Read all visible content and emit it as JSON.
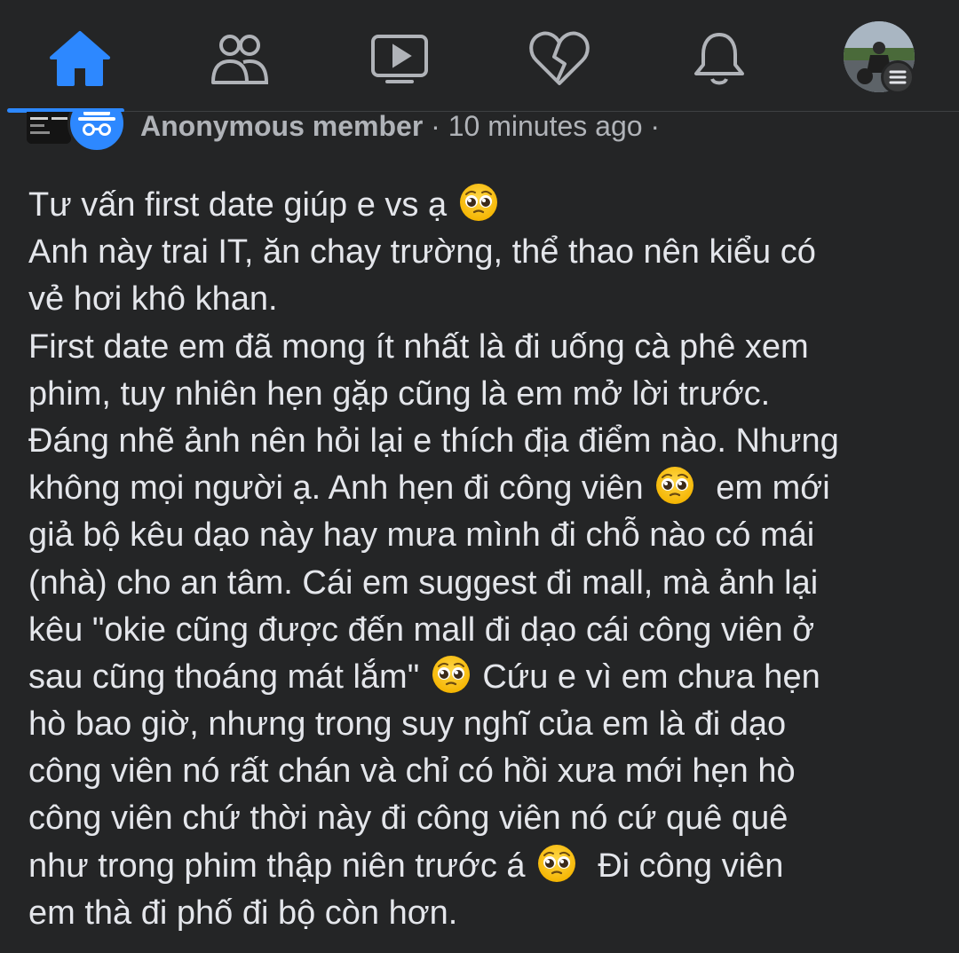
{
  "nav": {
    "items": [
      {
        "name": "home",
        "active": true
      },
      {
        "name": "friends",
        "active": false
      },
      {
        "name": "watch",
        "active": false
      },
      {
        "name": "dating",
        "active": false
      },
      {
        "name": "notifications",
        "active": false
      },
      {
        "name": "profile-menu",
        "active": false
      }
    ],
    "accent_color": "#2d88ff"
  },
  "post": {
    "author": "Anonymous member",
    "separator1": " · ",
    "time": "10 minutes ago",
    "separator2": " ·",
    "lines": [
      {
        "text": "Tư vấn first date giúp e vs ạ",
        "emoji": "pleading-face"
      },
      {
        "text": "Anh này trai IT, ăn chay trường, thể thao nên kiểu có"
      },
      {
        "text": "vẻ hơi khô khan."
      },
      {
        "text": "First date em đã mong ít nhất là đi uống cà phê xem"
      },
      {
        "text": "phim, tuy nhiên hẹn gặp cũng là em mở lời trước."
      },
      {
        "text": "Đáng nhẽ ảnh nên hỏi lại e thích địa điểm nào. Nhưng"
      },
      {
        "text": "không mọi người ạ. Anh hẹn đi công viên",
        "emoji": "pleading-face",
        "after": "  em mới"
      },
      {
        "text": "giả bộ kêu dạo này hay mưa mình đi chỗ nào có mái"
      },
      {
        "text": "(nhà) cho an tâm. Cái em suggest đi mall, mà ảnh lại"
      },
      {
        "text": "kêu \"okie cũng được đến mall đi dạo cái công viên ở"
      },
      {
        "text": "sau cũng thoáng mát lắm\"",
        "emoji": "pleading-face",
        "after": " Cứu e vì em chưa hẹn"
      },
      {
        "text": "hò bao giờ, nhưng trong suy nghĩ của em là đi dạo"
      },
      {
        "text": "công viên nó rất chán và chỉ có hồi xưa mới hẹn hò"
      },
      {
        "text": "công viên chứ thời này đi công viên nó cứ quê quê"
      },
      {
        "text": "như trong phim thập niên trước á",
        "emoji": "pleading-face",
        "after": "  Đi công viên"
      },
      {
        "text": "em thà đi phố đi bộ còn hơn."
      }
    ]
  }
}
